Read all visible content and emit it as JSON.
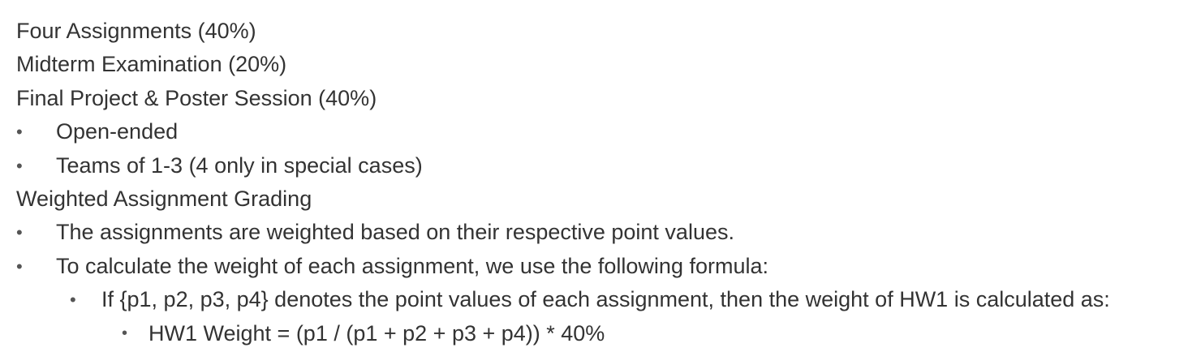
{
  "items": [
    {
      "level": 0,
      "text": "Four Assignments (40%)"
    },
    {
      "level": 0,
      "text": "Midterm Examination (20%)"
    },
    {
      "level": 0,
      "text": "Final Project & Poster Session (40%)"
    },
    {
      "level": 1,
      "text": "Open-ended"
    },
    {
      "level": 1,
      "text": "Teams of 1-3 (4 only in special cases)"
    },
    {
      "level": 0,
      "text": "Weighted Assignment Grading"
    },
    {
      "level": 1,
      "text": "The assignments are weighted based on their respective point values."
    },
    {
      "level": 1,
      "text": "To calculate the weight of each assignment, we use the following formula:"
    },
    {
      "level": 2,
      "text": "If {p1, p2, p3, p4} denotes the point values of each assignment, then the weight of HW1 is calculated as:"
    },
    {
      "level": 3,
      "text": "HW1 Weight = (p1 / (p1 + p2 + p3 + p4)) * 40%"
    }
  ],
  "bullet_glyph": "•"
}
